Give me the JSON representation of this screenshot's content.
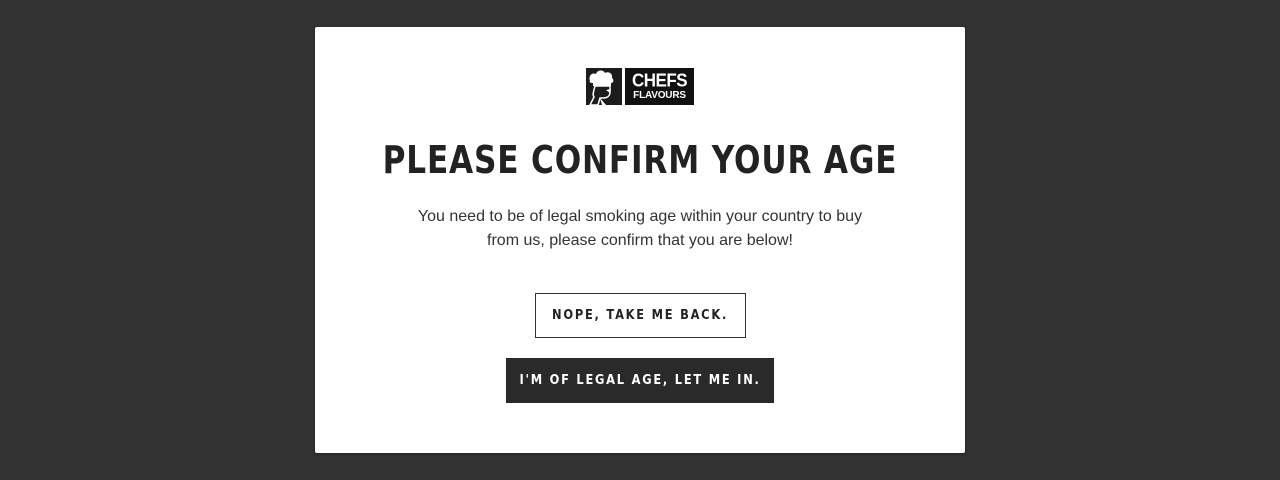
{
  "logo": {
    "line1": "CHEFS",
    "line2": "FLAVOURS",
    "icon": "chef-head-icon"
  },
  "modal": {
    "title": "PLEASE CONFIRM YOUR AGE",
    "message": "You need to be of legal smoking age within your country to buy from us, please confirm that you are below!",
    "decline_label": "NOPE, TAKE ME BACK.",
    "accept_label": "I'M OF LEGAL AGE, LET ME IN."
  },
  "colors": {
    "overlay": "#333333",
    "modal_bg": "#ffffff",
    "text": "#222222",
    "accept_button_bg": "#2a2a2a"
  }
}
